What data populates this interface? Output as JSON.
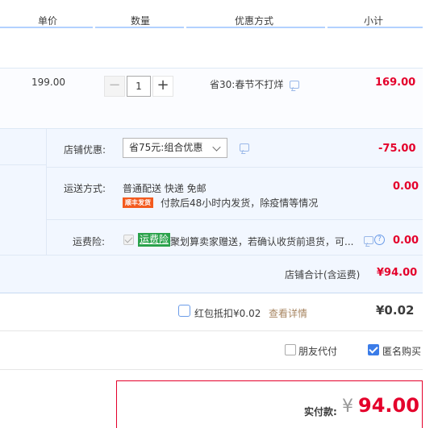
{
  "header": {
    "columns": [
      "单价",
      "数量",
      "优惠方式",
      "小计"
    ]
  },
  "item": {
    "unit_price": "199.00",
    "quantity": "1",
    "minus": "−",
    "plus": "+",
    "promo_text": "省30:春节不打烊",
    "subtotal": "169.00"
  },
  "shop": {
    "discount_label": "店铺优惠:",
    "discount_select": "省75元:组合优惠",
    "discount_amount": "-75.00",
    "shipping_label": "运送方式:",
    "shipping_method": "普通配送 快递 免邮",
    "shipping_badge": "顺丰发货",
    "shipping_note": "付款后48小时内发货，除疫情等情况",
    "shipping_amount": "0.00",
    "insurance_label": "运费险:",
    "insurance_tag": "运费险",
    "insurance_text": "聚划算卖家赠送，若确认收货前退货，可...",
    "insurance_amount": "0.00",
    "total_label": "店铺合计(含运费)",
    "total_amount": "¥94.00"
  },
  "redpacket": {
    "label": "红包抵扣¥0.02",
    "detail_link": "查看详情",
    "amount": "¥0.02"
  },
  "options": {
    "friend_pay": "朋友代付",
    "anonymous": "匿名购买"
  },
  "payment": {
    "label": "实付款:",
    "currency": "¥",
    "amount": "94.00"
  },
  "colors": {
    "accent_red": "#e4002b",
    "header_bar": "#b2d1ff",
    "panel_bg": "#f2f7ff",
    "link_brown": "#a78561",
    "check_blue": "#3b7ce8"
  }
}
